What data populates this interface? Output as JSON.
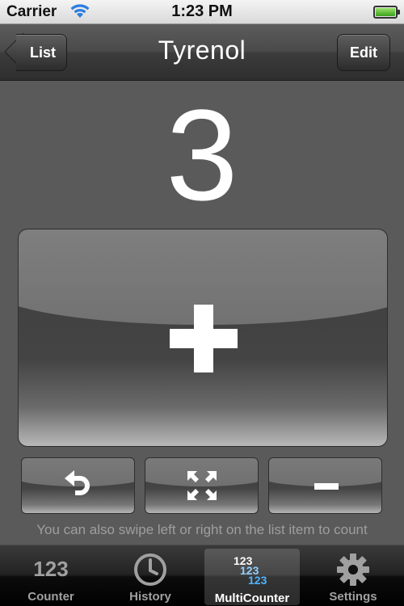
{
  "status_bar": {
    "carrier": "Carrier",
    "time": "1:23 PM",
    "battery_level": 1.0
  },
  "nav_bar": {
    "title": "Tyrenol",
    "back_label": "List",
    "edit_label": "Edit"
  },
  "counter": {
    "value": "3"
  },
  "hint": "You can also swipe left or right on the list item to count",
  "tab_bar": {
    "tabs": [
      {
        "label": "Counter",
        "icon_text": "123",
        "icon": "counter-123-icon",
        "selected": false
      },
      {
        "label": "History",
        "icon": "clock-icon",
        "selected": false
      },
      {
        "label": "MultiCounter",
        "icon_lines": [
          "123",
          "123",
          "123"
        ],
        "icon": "multicounter-icon",
        "selected": true
      },
      {
        "label": "Settings",
        "icon": "gear-icon",
        "selected": false
      }
    ]
  },
  "colors": {
    "accent_blue": "#4fb3ff",
    "tab_inactive": "#a0a0a0",
    "background": "#5a5a5a"
  }
}
